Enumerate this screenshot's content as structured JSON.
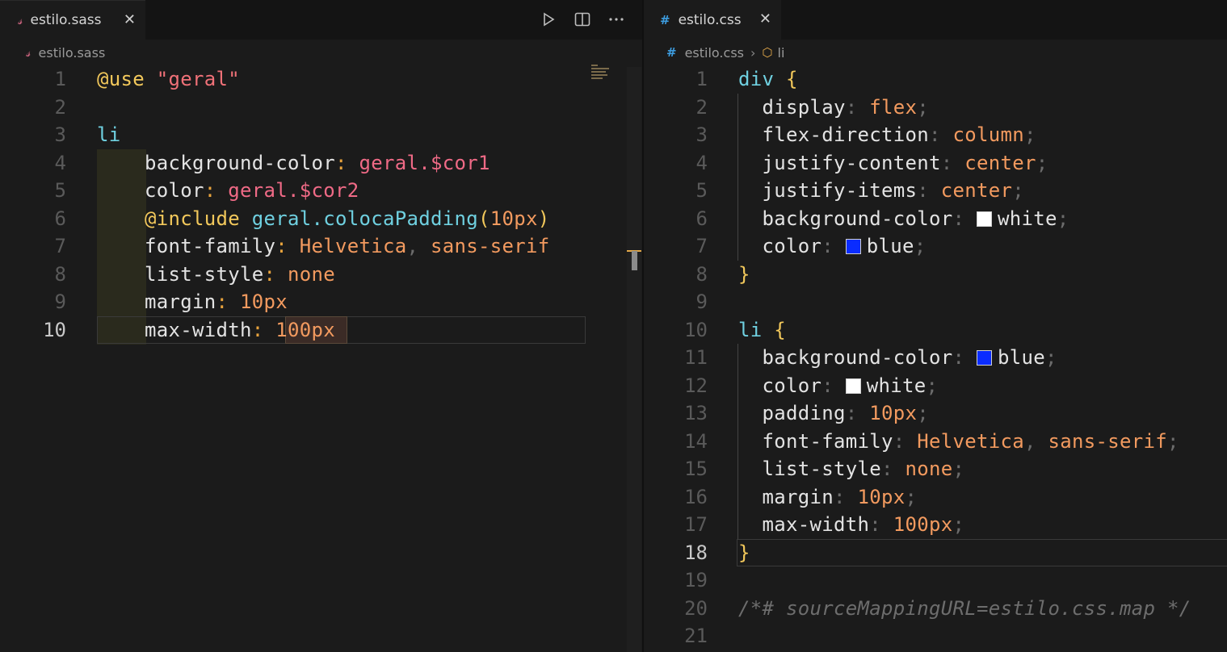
{
  "left_editor": {
    "tab": {
      "label": "estilo.sass",
      "icon": "sass-file-icon"
    },
    "breadcrumb": {
      "file": "estilo.sass"
    },
    "actions": [
      "run-icon",
      "split-editor-icon",
      "more-actions-icon"
    ],
    "active_line": "10",
    "line_numbers": [
      "1",
      "2",
      "3",
      "4",
      "5",
      "6",
      "7",
      "8",
      "9",
      "10"
    ],
    "lines": {
      "l1": {
        "kw": "@use",
        "str": "\"geral\""
      },
      "l3": {
        "sel": "li"
      },
      "l4": {
        "prop": "background-color",
        "colon": ":",
        "val": "geral.$cor1"
      },
      "l5": {
        "prop": "color",
        "colon": ":",
        "val": "geral.$cor2"
      },
      "l6": {
        "kw": "@include",
        "fn": "geral.colocaPadding",
        "open": "(",
        "num": "10px",
        "close": ")"
      },
      "l7": {
        "prop": "font-family",
        "colon": ":",
        "val1": "Helvetica",
        "comma": ",",
        "val2": "sans-serif"
      },
      "l8": {
        "prop": "list-style",
        "colon": ":",
        "val": "none"
      },
      "l9": {
        "prop": "margin",
        "colon": ":",
        "val": "10px"
      },
      "l10": {
        "prop": "max-width",
        "colon": ":",
        "val": "100px"
      }
    }
  },
  "right_editor": {
    "tab": {
      "label": "estilo.css",
      "icon": "css-file-icon"
    },
    "breadcrumb": {
      "file": "estilo.css",
      "symbol": "li"
    },
    "active_line": "18",
    "line_numbers": [
      "1",
      "2",
      "3",
      "4",
      "5",
      "6",
      "7",
      "8",
      "9",
      "10",
      "11",
      "12",
      "13",
      "14",
      "15",
      "16",
      "17",
      "18",
      "19",
      "20",
      "21"
    ],
    "lines": {
      "l1": {
        "sel": "div",
        "brace": "{"
      },
      "l2": {
        "prop": "display",
        "colon": ":",
        "val": "flex",
        "semi": ";"
      },
      "l3": {
        "prop": "flex-direction",
        "colon": ":",
        "val": "column",
        "semi": ";"
      },
      "l4": {
        "prop": "justify-content",
        "colon": ":",
        "val": "center",
        "semi": ";"
      },
      "l5": {
        "prop": "justify-items",
        "colon": ":",
        "val": "center",
        "semi": ";"
      },
      "l6": {
        "prop": "background-color",
        "colon": ":",
        "val": "white",
        "semi": ";",
        "swatch": "#ffffff"
      },
      "l7": {
        "prop": "color",
        "colon": ":",
        "val": "blue",
        "semi": ";",
        "swatch": "#0a2cff"
      },
      "l8": {
        "brace": "}"
      },
      "l10": {
        "sel": "li",
        "brace": "{"
      },
      "l11": {
        "prop": "background-color",
        "colon": ":",
        "val": "blue",
        "semi": ";",
        "swatch": "#0a2cff"
      },
      "l12": {
        "prop": "color",
        "colon": ":",
        "val": "white",
        "semi": ";",
        "swatch": "#ffffff"
      },
      "l13": {
        "prop": "padding",
        "colon": ":",
        "val": "10px",
        "semi": ";"
      },
      "l14": {
        "prop": "font-family",
        "colon": ":",
        "val1": "Helvetica",
        "comma": ",",
        "val2": "sans-serif",
        "semi": ";"
      },
      "l15": {
        "prop": "list-style",
        "colon": ":",
        "val": "none",
        "semi": ";"
      },
      "l16": {
        "prop": "margin",
        "colon": ":",
        "val": "10px",
        "semi": ";"
      },
      "l17": {
        "prop": "max-width",
        "colon": ":",
        "val": "100px",
        "semi": ";"
      },
      "l18": {
        "brace": "}"
      },
      "l20": {
        "comment": "/*# sourceMappingURL=estilo.css.map */"
      }
    }
  }
}
